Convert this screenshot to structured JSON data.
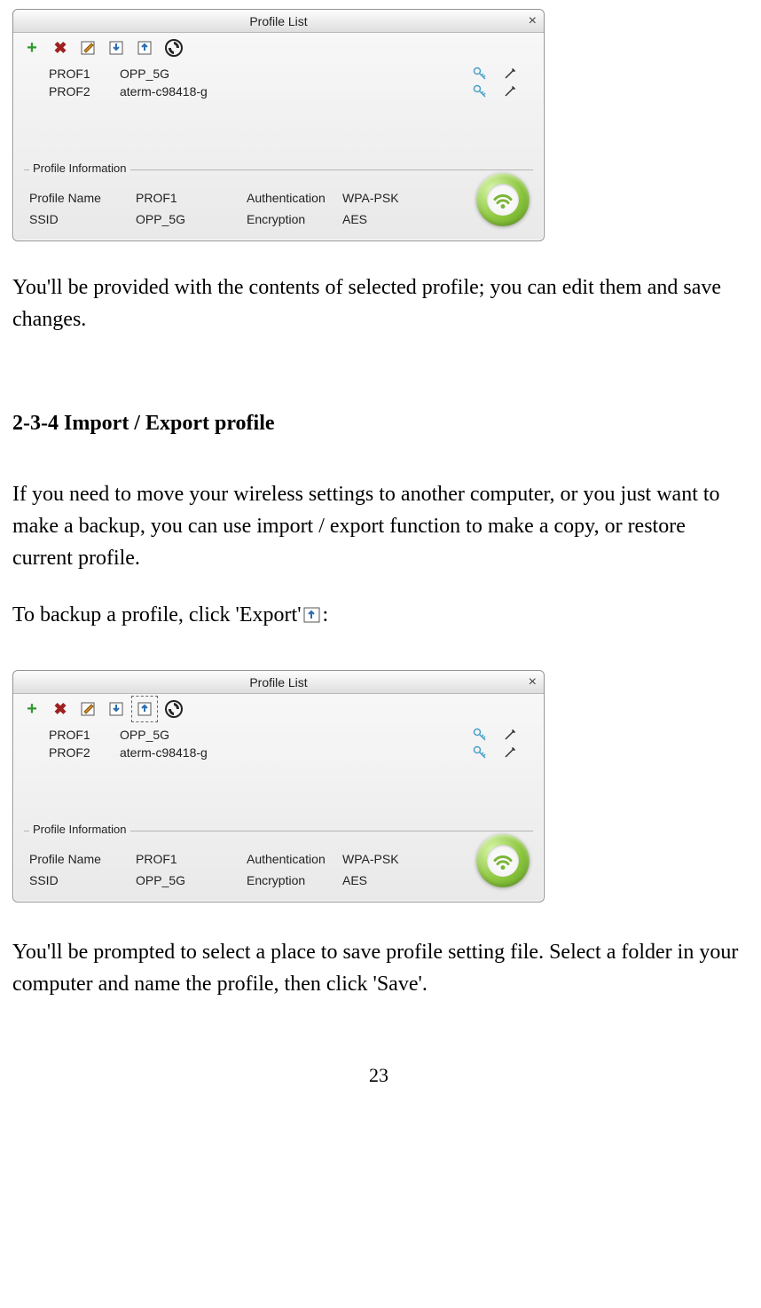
{
  "window1": {
    "title": "Profile List",
    "profiles": [
      {
        "name": "PROF1",
        "ssid": "OPP_5G"
      },
      {
        "name": "PROF2",
        "ssid": "aterm-c98418-g"
      }
    ],
    "info": {
      "legend": "Profile Information",
      "profile_name_label": "Profile Name",
      "profile_name_value": "PROF1",
      "ssid_label": "SSID",
      "ssid_value": "OPP_5G",
      "auth_label": "Authentication",
      "auth_value": "WPA-PSK",
      "enc_label": "Encryption",
      "enc_value": "AES"
    }
  },
  "paragraph1": "You'll be provided with the contents of selected profile; you can edit them and save changes.",
  "heading": "2-3-4 Import / Export profile",
  "paragraph2": "If you need to move your wireless settings to another computer, or you just want to make a backup, you can use import / export function to make a copy, or restore current profile.",
  "paragraph3_pre": "To backup a profile, click 'Export' ",
  "paragraph3_post": ":",
  "window2": {
    "title": "Profile List",
    "profiles": [
      {
        "name": "PROF1",
        "ssid": "OPP_5G"
      },
      {
        "name": "PROF2",
        "ssid": "aterm-c98418-g"
      }
    ],
    "info": {
      "legend": "Profile Information",
      "profile_name_label": "Profile Name",
      "profile_name_value": "PROF1",
      "ssid_label": "SSID",
      "ssid_value": "OPP_5G",
      "auth_label": "Authentication",
      "auth_value": "WPA-PSK",
      "enc_label": "Encryption",
      "enc_value": "AES"
    }
  },
  "paragraph4": "You'll be prompted to select a place to save profile setting file. Select a folder in your computer and name the profile, then click 'Save'.",
  "page_number": "23"
}
